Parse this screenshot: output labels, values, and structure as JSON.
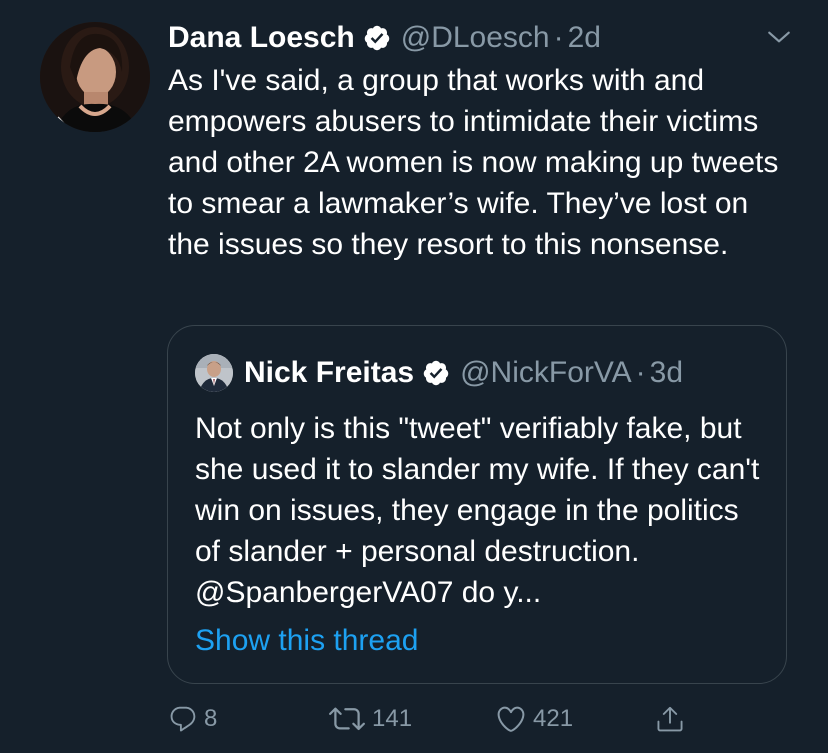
{
  "tweet": {
    "author_name": "Dana Loesch",
    "handle": "@DLoesch",
    "separator": "·",
    "time": "2d",
    "text": "As I've said, a group that works with and empowers abusers to intimidate their victims and other 2A women is now making up tweets to smear a lawmaker’s wife. They’ve lost on the issues so they resort to this nonsense.",
    "verified_icon": "verified-badge-icon",
    "menu_icon": "chevron-down-icon"
  },
  "quoted_tweet": {
    "author_name": "Nick Freitas",
    "handle": "@NickForVA",
    "separator": "·",
    "time": "3d",
    "text": "Not only is this \"tweet\" verifiably fake, but she used it to slander my wife. If they can't win on issues, they engage in the politics of slander + personal destruction. @SpanbergerVA07 do y...",
    "show_thread_label": "Show this thread"
  },
  "actions": {
    "replies": "8",
    "retweets": "141",
    "likes": "421",
    "reply_icon": "reply-icon",
    "retweet_icon": "retweet-icon",
    "like_icon": "heart-icon",
    "share_icon": "share-icon"
  },
  "colors": {
    "background": "#15202b",
    "text": "#ffffff",
    "secondary_text": "#8899a6",
    "link": "#1da1f2",
    "border": "#38444d",
    "verified": "#ffffff"
  }
}
